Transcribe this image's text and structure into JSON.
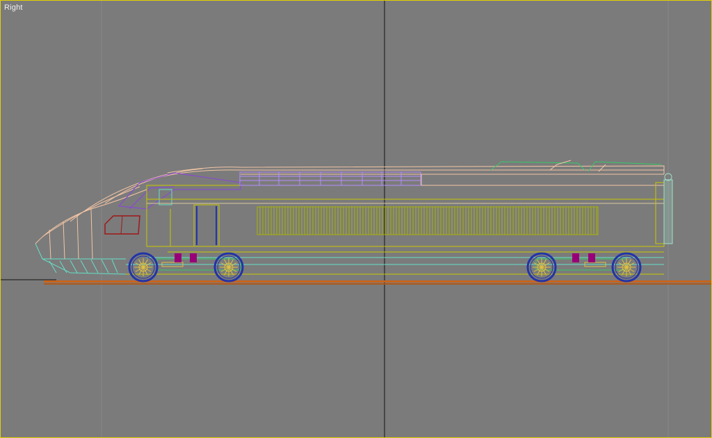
{
  "viewport": {
    "label": "Right",
    "border_color": "#e4d200",
    "background": "#7b7b7b"
  },
  "scene": {
    "object": "high-speed-train-power-car",
    "display_mode": "wireframe",
    "colors": {
      "roof": "#f5c6a5",
      "body": "#c8c800",
      "grille": "#a8b400",
      "window": "#b48cff",
      "cab": "#8844dd",
      "bogie": "#33cc66",
      "wheel": "#2233aa",
      "wheel_hub": "#e0c040",
      "brake_block": "#990077",
      "rail": "#c8641e",
      "end_cap": "#9fe0c8",
      "nose": "#66e0c8",
      "windshield": "#a01818",
      "world_axis": "#111111",
      "grid": "#8a8a8a"
    }
  }
}
